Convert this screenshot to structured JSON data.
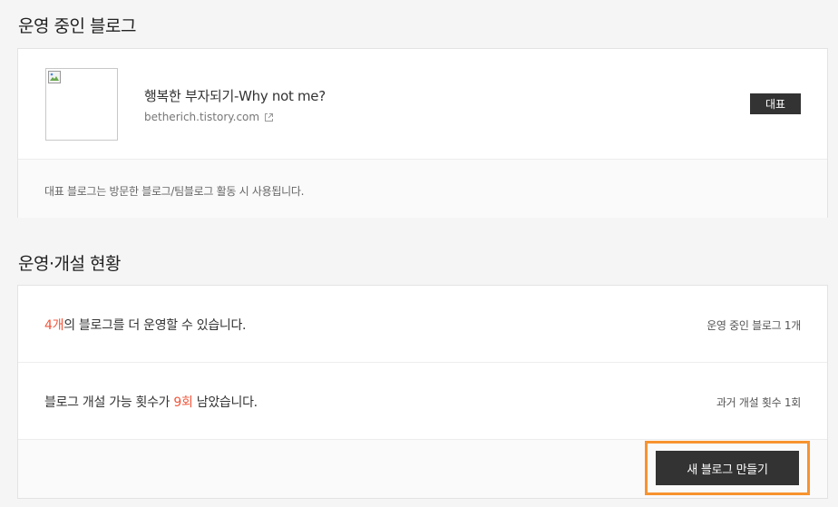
{
  "representative": {
    "section_title": "운영 중인 블로그",
    "blog_name": "행복한 부자되기-Why not me?",
    "blog_url": "betherich.tistory.com",
    "badge_label": "대표",
    "notice": "대표 블로그는 방문한 블로그/팀블로그 활동 시 사용됩니다.",
    "thumbnail_icon": "broken-image-icon",
    "url_icon": "external-link-icon"
  },
  "status": {
    "section_title": "운영·개설 현황",
    "operate": {
      "count": "4개",
      "text_suffix": "의 블로그를 더 운영할 수 있습니다.",
      "side": "운영 중인 블로그 1개"
    },
    "create": {
      "text_prefix": "블로그 개설 가능 횟수가 ",
      "count": "9회",
      "text_suffix": " 남았습니다.",
      "side": "과거 개설 횟수 1회"
    },
    "create_button_label": "새 블로그 만들기"
  },
  "colors": {
    "highlight": "#f0563c",
    "button_bg": "#333333",
    "focus_outline": "#f7932f"
  }
}
